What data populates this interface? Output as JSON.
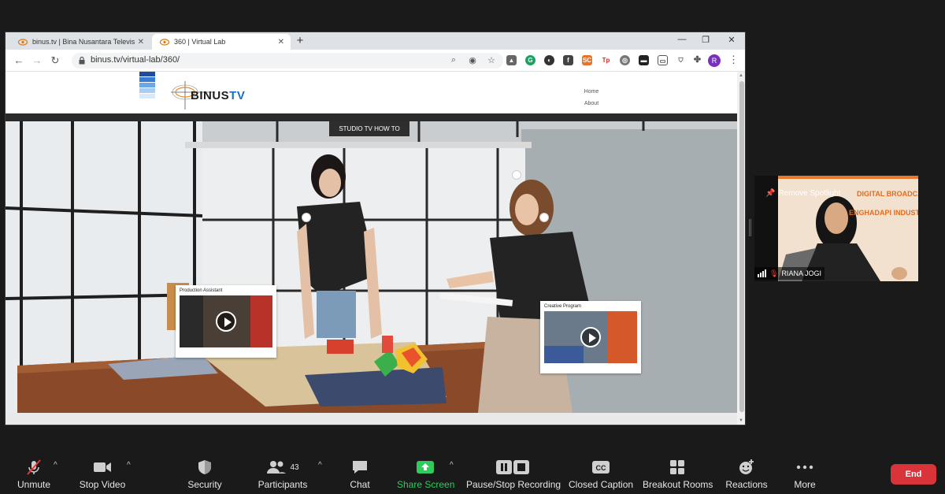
{
  "browser": {
    "tabs": [
      {
        "title": "binus.tv | Bina Nusantara Televisi",
        "active": false
      },
      {
        "title": "360 | Virtual Lab",
        "active": true
      }
    ],
    "url": "binus.tv/virtual-lab/360/",
    "profile_initial": "R",
    "extensions": [
      "warning-icon",
      "g-icon",
      "moon-icon",
      "f-icon",
      "sc-icon",
      "tp-icon",
      "compass-icon",
      "mask-icon",
      "chat-icon",
      "shield-icon",
      "puzzle-icon"
    ]
  },
  "site": {
    "logo_text": "BINUS",
    "logo_tv": "TV",
    "nav": [
      "Home",
      "About"
    ]
  },
  "scene": {
    "banner": "STUDIO TV HOW TO",
    "cards": [
      {
        "title": "Production Assistant"
      },
      {
        "title": "Creative Program"
      }
    ]
  },
  "participant": {
    "spotlight_label": "Remove Spotlight",
    "name": "RIANA JOGI",
    "slide_title_1": "DIGITAL BROADCAST",
    "slide_title_2": "ENGHADAPI INDUSTR"
  },
  "toolbar": {
    "unmute": "Unmute",
    "stop_video": "Stop Video",
    "security": "Security",
    "participants": "Participants",
    "participants_count": "43",
    "chat": "Chat",
    "share_screen": "Share Screen",
    "recording": "Pause/Stop Recording",
    "closed_caption": "Closed Caption",
    "breakout": "Breakout Rooms",
    "reactions": "Reactions",
    "more": "More",
    "end": "End"
  },
  "colors": {
    "end_button": "#d9343a",
    "share_green": "#2fcb5c",
    "brand_blue": "#1a6fc4"
  }
}
